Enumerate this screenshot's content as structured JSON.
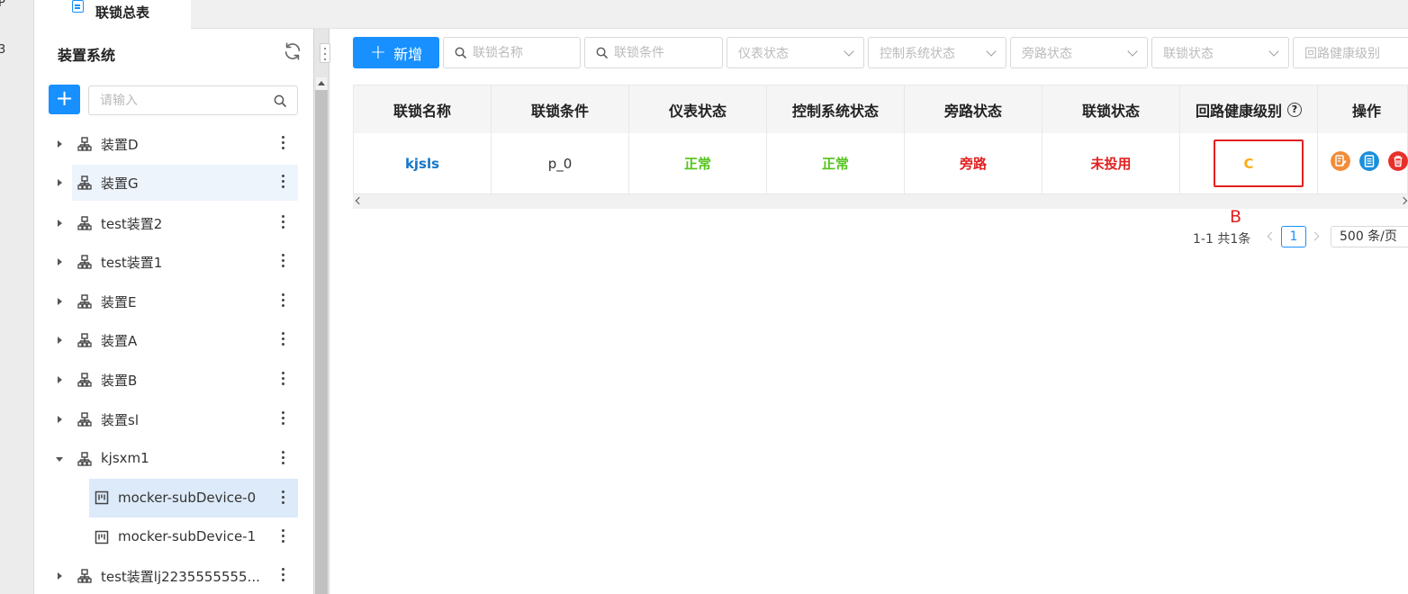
{
  "rail": {
    "glyphs": [
      "P",
      "3"
    ]
  },
  "tabs": [
    {
      "label": "联锁总表",
      "icon": "document-icon"
    }
  ],
  "sidebar": {
    "title": "装置系统",
    "search_placeholder": "请输入",
    "items": [
      {
        "label": "装置D",
        "level": 0,
        "expanded": false,
        "icon": "org-tree-icon"
      },
      {
        "label": "装置G",
        "level": 0,
        "expanded": false,
        "icon": "org-tree-icon",
        "hover": true
      },
      {
        "label": "test装置2",
        "level": 0,
        "expanded": false,
        "icon": "org-tree-icon"
      },
      {
        "label": "test装置1",
        "level": 0,
        "expanded": false,
        "icon": "org-tree-icon"
      },
      {
        "label": "装置E",
        "level": 0,
        "expanded": false,
        "icon": "org-tree-icon"
      },
      {
        "label": "装置A",
        "level": 0,
        "expanded": false,
        "icon": "org-tree-icon"
      },
      {
        "label": "装置B",
        "level": 0,
        "expanded": false,
        "icon": "org-tree-icon"
      },
      {
        "label": "装置sl",
        "level": 0,
        "expanded": false,
        "icon": "org-tree-icon"
      },
      {
        "label": "kjsxm1",
        "level": 0,
        "expanded": true,
        "icon": "org-tree-icon"
      },
      {
        "label": "mocker-subDevice-0",
        "level": 1,
        "icon": "device-icon",
        "selected": true
      },
      {
        "label": "mocker-subDevice-1",
        "level": 1,
        "icon": "device-icon"
      },
      {
        "label": "test装置lj2235555555...",
        "level": 0,
        "expanded": false,
        "icon": "org-tree-icon"
      }
    ]
  },
  "toolbar": {
    "new_label": "新增",
    "filters": [
      {
        "placeholder": "联锁名称",
        "type": "search"
      },
      {
        "placeholder": "联锁条件",
        "type": "search"
      },
      {
        "placeholder": "仪表状态",
        "type": "select"
      },
      {
        "placeholder": "控制系统状态",
        "type": "select"
      },
      {
        "placeholder": "旁路状态",
        "type": "select"
      },
      {
        "placeholder": "联锁状态",
        "type": "select"
      },
      {
        "placeholder": "回路健康级别",
        "type": "select"
      }
    ]
  },
  "table": {
    "headers": [
      "联锁名称",
      "联锁条件",
      "仪表状态",
      "控制系统状态",
      "旁路状态",
      "联锁状态",
      "回路健康级别",
      "操作"
    ],
    "rows": [
      {
        "name": "kjsls",
        "condition": "p_0",
        "instrument": "正常",
        "control": "正常",
        "bypass": "旁路",
        "interlock": "未投用",
        "health": "C"
      }
    ],
    "ops": [
      "edit-icon",
      "detail-icon",
      "delete-icon"
    ]
  },
  "annotation": {
    "label": "B"
  },
  "pagination": {
    "total": "1-1 共1条",
    "current": "1",
    "page_size": "500 条/页"
  },
  "colors": {
    "primary": "#1890ff",
    "link": "#1677c9",
    "ok": "#52c41a",
    "danger": "#e02020",
    "warning": "#faad14"
  }
}
